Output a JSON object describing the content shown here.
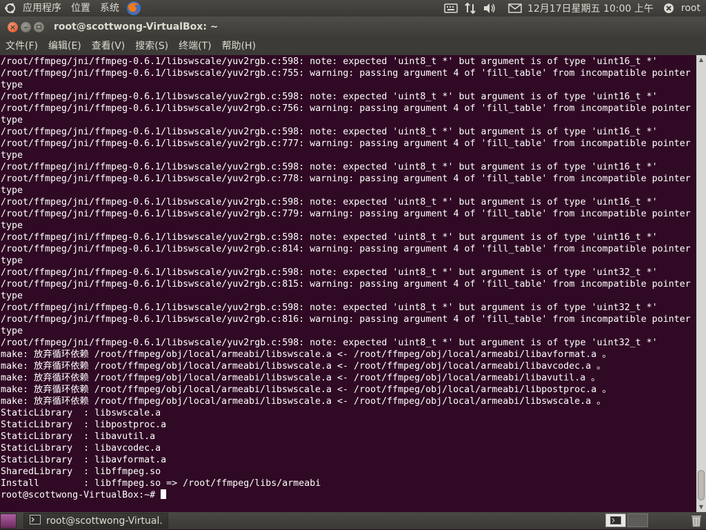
{
  "top_panel": {
    "menus": [
      "应用程序",
      "位置",
      "系统"
    ],
    "datetime": "12月17日星期五 10:00 上午",
    "user": "root"
  },
  "window": {
    "title": "root@scottwong-VirtualBox: ~"
  },
  "menubar": {
    "items": [
      "文件(F)",
      "编辑(E)",
      "查看(V)",
      "搜索(S)",
      "终端(T)",
      "帮助(H)"
    ]
  },
  "terminal": {
    "lines": [
      "/root/ffmpeg/jni/ffmpeg-0.6.1/libswscale/yuv2rgb.c:598: note: expected 'uint8_t *' but argument is of type 'uint16_t *'",
      "/root/ffmpeg/jni/ffmpeg-0.6.1/libswscale/yuv2rgb.c:755: warning: passing argument 4 of 'fill_table' from incompatible pointer",
      "type",
      "/root/ffmpeg/jni/ffmpeg-0.6.1/libswscale/yuv2rgb.c:598: note: expected 'uint8_t *' but argument is of type 'uint16_t *'",
      "/root/ffmpeg/jni/ffmpeg-0.6.1/libswscale/yuv2rgb.c:756: warning: passing argument 4 of 'fill_table' from incompatible pointer",
      "type",
      "/root/ffmpeg/jni/ffmpeg-0.6.1/libswscale/yuv2rgb.c:598: note: expected 'uint8_t *' but argument is of type 'uint16_t *'",
      "/root/ffmpeg/jni/ffmpeg-0.6.1/libswscale/yuv2rgb.c:777: warning: passing argument 4 of 'fill_table' from incompatible pointer",
      "type",
      "/root/ffmpeg/jni/ffmpeg-0.6.1/libswscale/yuv2rgb.c:598: note: expected 'uint8_t *' but argument is of type 'uint16_t *'",
      "/root/ffmpeg/jni/ffmpeg-0.6.1/libswscale/yuv2rgb.c:778: warning: passing argument 4 of 'fill_table' from incompatible pointer",
      "type",
      "/root/ffmpeg/jni/ffmpeg-0.6.1/libswscale/yuv2rgb.c:598: note: expected 'uint8_t *' but argument is of type 'uint16_t *'",
      "/root/ffmpeg/jni/ffmpeg-0.6.1/libswscale/yuv2rgb.c:779: warning: passing argument 4 of 'fill_table' from incompatible pointer",
      "type",
      "/root/ffmpeg/jni/ffmpeg-0.6.1/libswscale/yuv2rgb.c:598: note: expected 'uint8_t *' but argument is of type 'uint16_t *'",
      "/root/ffmpeg/jni/ffmpeg-0.6.1/libswscale/yuv2rgb.c:814: warning: passing argument 4 of 'fill_table' from incompatible pointer",
      "type",
      "/root/ffmpeg/jni/ffmpeg-0.6.1/libswscale/yuv2rgb.c:598: note: expected 'uint8_t *' but argument is of type 'uint32_t *'",
      "/root/ffmpeg/jni/ffmpeg-0.6.1/libswscale/yuv2rgb.c:815: warning: passing argument 4 of 'fill_table' from incompatible pointer",
      "type",
      "/root/ffmpeg/jni/ffmpeg-0.6.1/libswscale/yuv2rgb.c:598: note: expected 'uint8_t *' but argument is of type 'uint32_t *'",
      "/root/ffmpeg/jni/ffmpeg-0.6.1/libswscale/yuv2rgb.c:816: warning: passing argument 4 of 'fill_table' from incompatible pointer",
      "type",
      "/root/ffmpeg/jni/ffmpeg-0.6.1/libswscale/yuv2rgb.c:598: note: expected 'uint8_t *' but argument is of type 'uint32_t *'",
      "make: 放弃循环依赖 /root/ffmpeg/obj/local/armeabi/libswscale.a <- /root/ffmpeg/obj/local/armeabi/libavformat.a 。",
      "make: 放弃循环依赖 /root/ffmpeg/obj/local/armeabi/libswscale.a <- /root/ffmpeg/obj/local/armeabi/libavcodec.a 。",
      "make: 放弃循环依赖 /root/ffmpeg/obj/local/armeabi/libswscale.a <- /root/ffmpeg/obj/local/armeabi/libavutil.a 。",
      "make: 放弃循环依赖 /root/ffmpeg/obj/local/armeabi/libswscale.a <- /root/ffmpeg/obj/local/armeabi/libpostproc.a 。",
      "make: 放弃循环依赖 /root/ffmpeg/obj/local/armeabi/libswscale.a <- /root/ffmpeg/obj/local/armeabi/libswscale.a 。",
      "StaticLibrary  : libswscale.a",
      "StaticLibrary  : libpostproc.a",
      "StaticLibrary  : libavutil.a",
      "StaticLibrary  : libavcodec.a",
      "StaticLibrary  : libavformat.a",
      "SharedLibrary  : libffmpeg.so",
      "Install        : libffmpeg.so => /root/ffmpeg/libs/armeabi"
    ],
    "prompt": "root@scottwong-VirtualBox:~# "
  },
  "bottom_panel": {
    "task_label": "root@scottwong-Virtual..."
  },
  "colors": {
    "terminal_bg": "#300a24",
    "terminal_fg": "#ffffff",
    "panel_bg": "#3c3b37",
    "close_button": "#df4a16"
  }
}
